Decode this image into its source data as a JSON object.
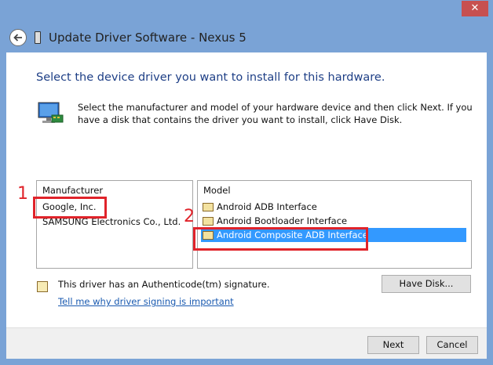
{
  "window": {
    "close_glyph": "✕",
    "title": "Update Driver Software - Nexus 5"
  },
  "content": {
    "heading": "Select the device driver you want to install for this hardware.",
    "description": "Select the manufacturer and model of your hardware device and then click Next. If you have a disk that contains the driver you want to install, click Have Disk."
  },
  "manufacturer": {
    "header": "Manufacturer",
    "items": [
      "Google, Inc.",
      "SAMSUNG Electronics Co., Ltd."
    ]
  },
  "model": {
    "header": "Model",
    "items": [
      "Android ADB Interface",
      "Android Bootloader Interface",
      "Android Composite ADB Interface"
    ]
  },
  "annotations": {
    "step1": "1",
    "step2": "2",
    "color": "#e0232a"
  },
  "signature": {
    "text": "This driver has an Authenticode(tm) signature.",
    "link": "Tell me why driver signing is important"
  },
  "buttons": {
    "have_disk": "Have Disk...",
    "next": "Next",
    "cancel": "Cancel"
  },
  "colors": {
    "frame": "#7aa3d6",
    "heading": "#1e3f86",
    "selection": "#3399ff",
    "link": "#1a5ab0"
  }
}
